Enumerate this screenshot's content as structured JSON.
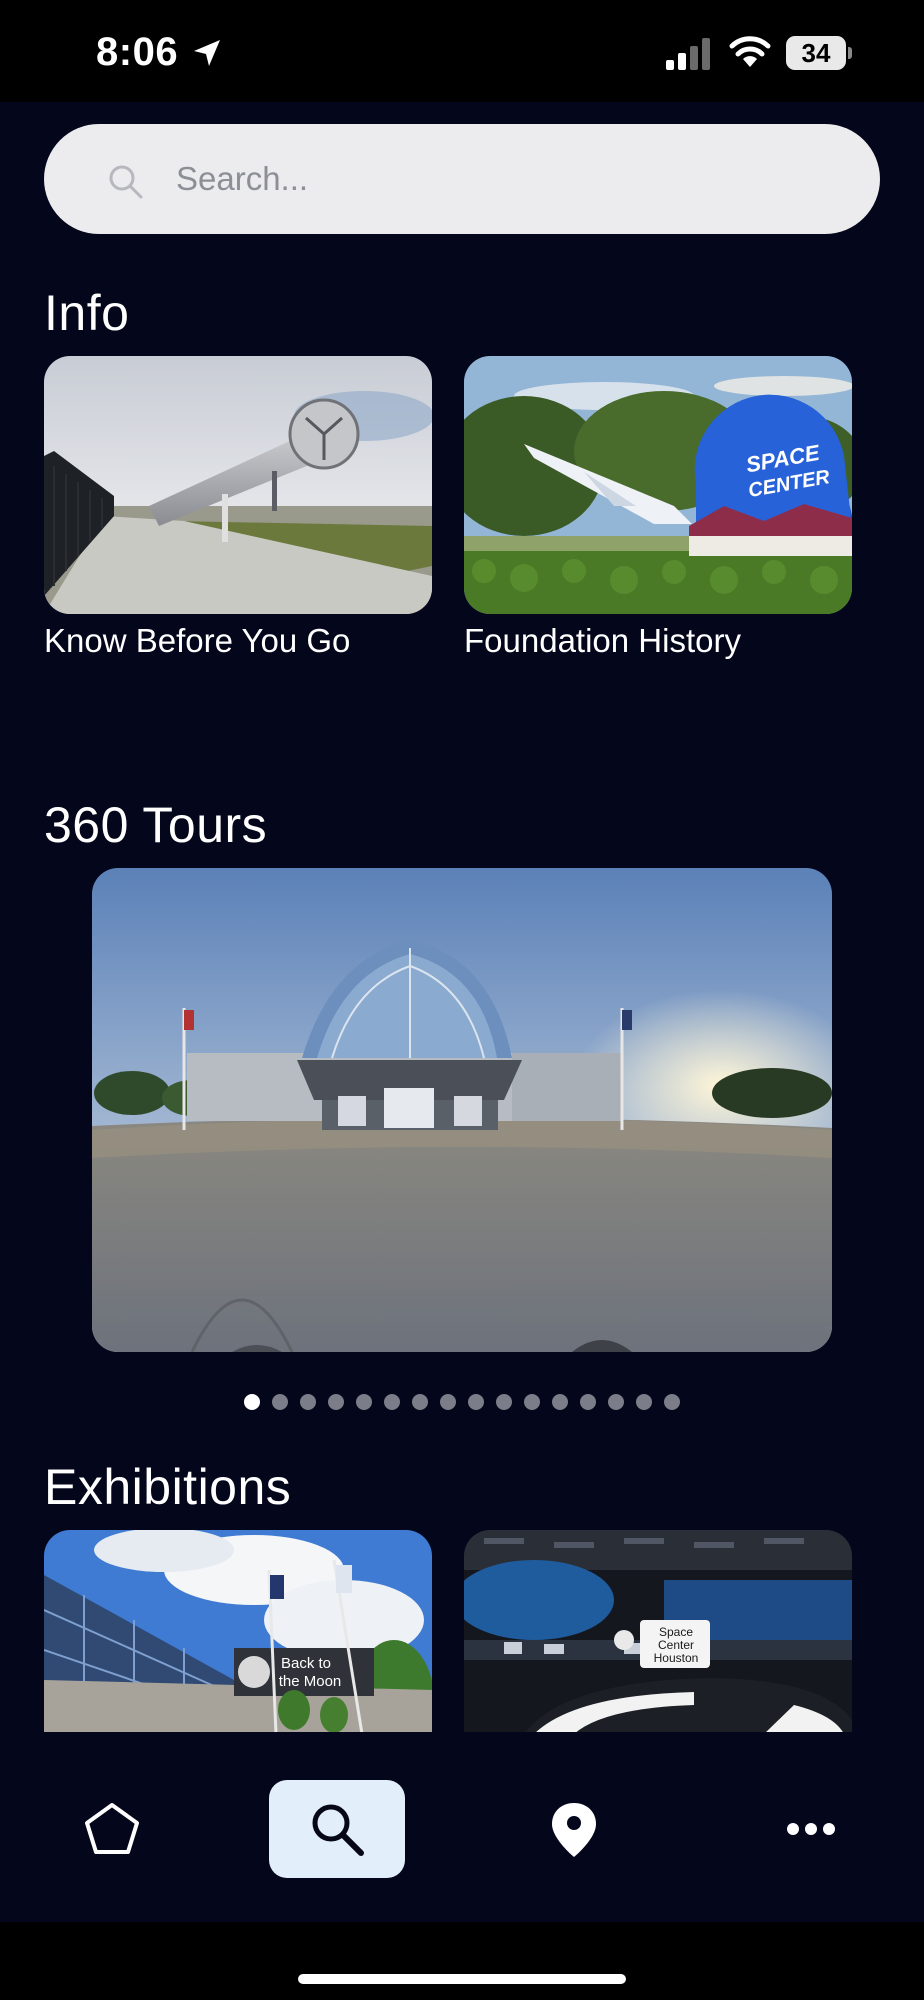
{
  "status_bar": {
    "time": "8:06",
    "battery": "34"
  },
  "search": {
    "placeholder": "Search..."
  },
  "sections": {
    "info": {
      "title": "Info",
      "cards": [
        {
          "label": "Know Before You Go",
          "image": "rocket-on-display-photo"
        },
        {
          "label": "Foundation History",
          "image": "space-center-entrance-photo"
        }
      ]
    },
    "tours": {
      "title": "360 Tours",
      "image": "panorama-building-entrance-photo",
      "pagination": {
        "total": 16,
        "active_index": 0
      }
    },
    "exhibitions": {
      "title": "Exhibitions",
      "cards": [
        {
          "image": "back-to-the-moon-building-photo",
          "sign_text": [
            "Back to",
            "the Moon"
          ]
        },
        {
          "image": "space-center-houston-hall-photo",
          "sign_text": [
            "Space",
            "Center",
            "Houston"
          ]
        }
      ]
    }
  },
  "tab_bar": {
    "items": [
      {
        "name": "home",
        "icon": "pentagon-home-icon",
        "active": false
      },
      {
        "name": "search",
        "icon": "magnifier-icon",
        "active": true
      },
      {
        "name": "map",
        "icon": "location-pin-icon",
        "active": false
      },
      {
        "name": "more",
        "icon": "ellipsis-icon",
        "active": false
      }
    ]
  },
  "colors": {
    "background": "#04061c",
    "search_field": "#ececef",
    "active_tab": "#e3eefb",
    "active_dot": "#ffffff",
    "inactive_dot": "#7b7d88"
  }
}
